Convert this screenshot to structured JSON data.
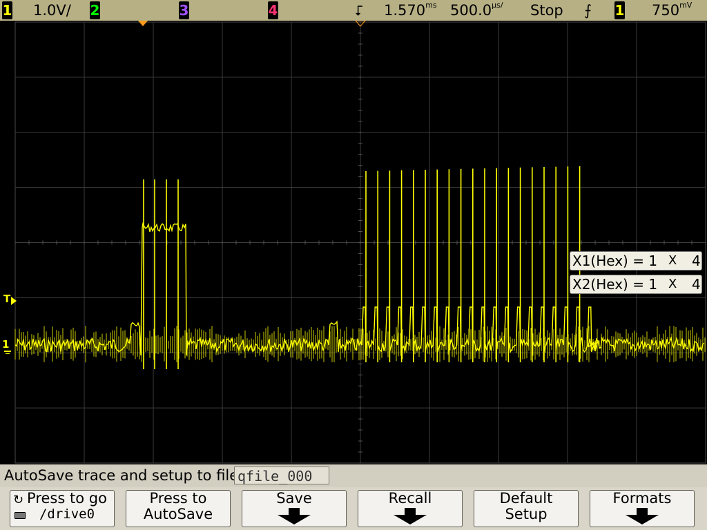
{
  "top_bar": {
    "ch1_num": "1",
    "ch1_scale": "1.0V/",
    "ch2_num": "2",
    "ch3_num": "3",
    "ch4_num": "4",
    "trig_symbol": "⮦",
    "delay": "1.570",
    "delay_unit": "ms",
    "timebase": "500.0",
    "timebase_unit": "µs/",
    "run_state": "Stop",
    "slope_symbol": "⨍",
    "trig_source": "1",
    "trig_level": "750",
    "trig_level_unit": "mV"
  },
  "markers": {
    "trigger_level_label": "T",
    "ch1_ground_label": "1"
  },
  "cursor_readouts": [
    {
      "label": "X1(Hex) = 1",
      "sep": "X",
      "value": "4"
    },
    {
      "label": "X2(Hex) = 1",
      "sep": "X",
      "value": "4"
    }
  ],
  "autosave": {
    "label": "AutoSave trace and setup to file:",
    "filename": "qfile_000"
  },
  "softkeys": [
    {
      "line1": "Press to go",
      "line2": "/drive0"
    },
    {
      "line1": "Press to",
      "line2": "AutoSave"
    },
    {
      "line1": "Save",
      "line2": ""
    },
    {
      "line1": "Recall",
      "line2": ""
    },
    {
      "line1": "Default",
      "line2": "Setup"
    },
    {
      "line1": "Formats",
      "line2": ""
    }
  ],
  "colors": {
    "ch1": "#ffff00",
    "ch2": "#00ff00",
    "ch3": "#a050ff",
    "ch4": "#ff3070",
    "marker": "#ff9a1a",
    "status_bar": "#b7b085"
  }
}
